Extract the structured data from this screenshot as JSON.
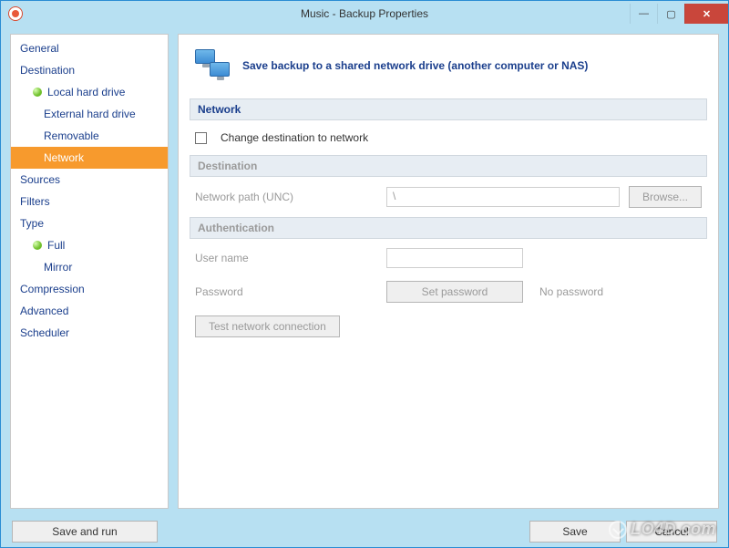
{
  "window": {
    "title": "Music - Backup Properties"
  },
  "sidebar": {
    "items": [
      {
        "label": "General"
      },
      {
        "label": "Destination"
      },
      {
        "label": "Local hard drive"
      },
      {
        "label": "External hard drive"
      },
      {
        "label": "Removable"
      },
      {
        "label": "Network"
      },
      {
        "label": "Sources"
      },
      {
        "label": "Filters"
      },
      {
        "label": "Type"
      },
      {
        "label": "Full"
      },
      {
        "label": "Mirror"
      },
      {
        "label": "Compression"
      },
      {
        "label": "Advanced"
      },
      {
        "label": "Scheduler"
      }
    ]
  },
  "main": {
    "header": "Save backup to a shared network drive (another computer or NAS)",
    "section_network": "Network",
    "change_dest_label": "Change destination to network",
    "section_destination": "Destination",
    "network_path_label": "Network path (UNC)",
    "network_path_value": "\\",
    "browse_label": "Browse...",
    "section_auth": "Authentication",
    "username_label": "User name",
    "password_label": "Password",
    "set_password_label": "Set password",
    "no_password_text": "No password",
    "test_connection_label": "Test network connection"
  },
  "footer": {
    "save_and_run": "Save and run",
    "save": "Save",
    "cancel": "Cancel"
  },
  "watermark": "LO4D.com"
}
